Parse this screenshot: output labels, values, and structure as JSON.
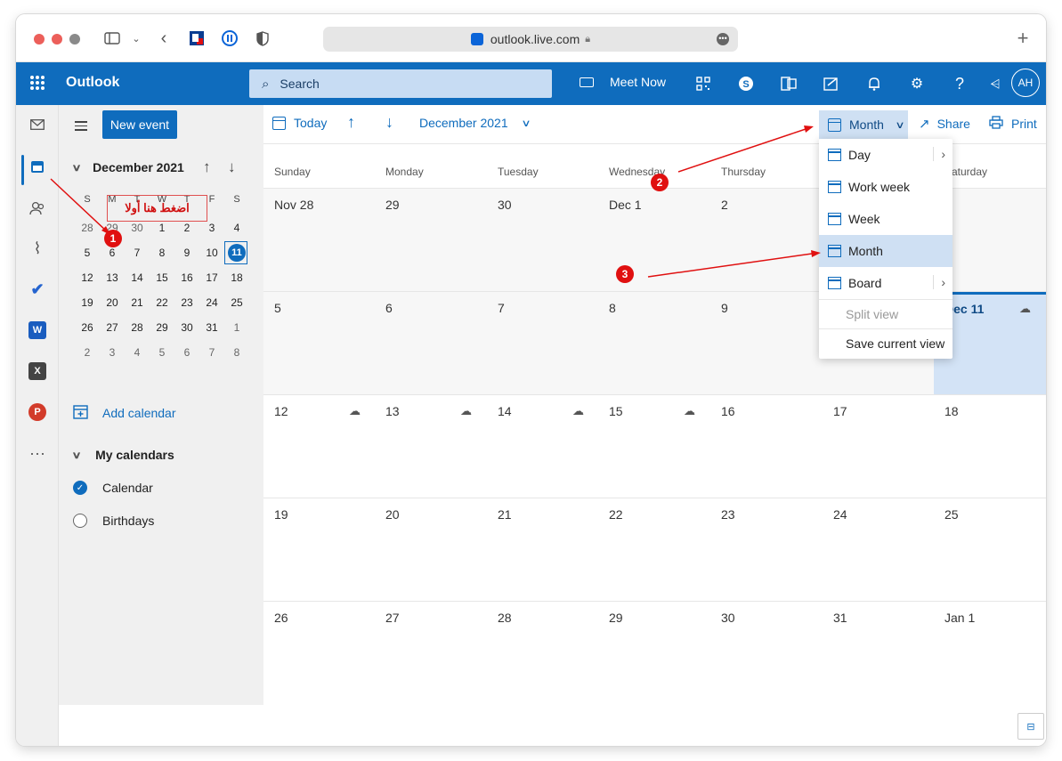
{
  "browser": {
    "url": "outlook.live.com"
  },
  "app": {
    "brand": "Outlook",
    "search_placeholder": "Search",
    "meet_now": "Meet Now",
    "avatar_initials": "AH"
  },
  "folder_pane": {
    "new_event": "New event",
    "mini_month": "December 2021",
    "dow": [
      "S",
      "M",
      "T",
      "W",
      "T",
      "F",
      "S"
    ],
    "weeks": [
      [
        "28",
        "29",
        "30",
        "1",
        "2",
        "3",
        "4"
      ],
      [
        "5",
        "6",
        "7",
        "8",
        "9",
        "10",
        "11"
      ],
      [
        "12",
        "13",
        "14",
        "15",
        "16",
        "17",
        "18"
      ],
      [
        "19",
        "20",
        "21",
        "22",
        "23",
        "24",
        "25"
      ],
      [
        "26",
        "27",
        "28",
        "29",
        "30",
        "31",
        "1"
      ],
      [
        "2",
        "3",
        "4",
        "5",
        "6",
        "7",
        "8"
      ]
    ],
    "add_calendar": "Add calendar",
    "my_calendars": "My calendars",
    "calendars": [
      "Calendar",
      "Birthdays"
    ]
  },
  "commands": {
    "today": "Today",
    "period": "December 2021",
    "view": "Month",
    "share": "Share",
    "print": "Print"
  },
  "grid": {
    "weekdays": [
      "Sunday",
      "Monday",
      "Tuesday",
      "Wednesday",
      "Thursday",
      "",
      "Saturday"
    ],
    "weeks": [
      [
        "Nov 28",
        "29",
        "30",
        "Dec 1",
        "2",
        "",
        ""
      ],
      [
        "5",
        "6",
        "7",
        "8",
        "9",
        "",
        "Dec 11"
      ],
      [
        "12",
        "13",
        "14",
        "15",
        "16",
        "17",
        "18"
      ],
      [
        "19",
        "20",
        "21",
        "22",
        "23",
        "24",
        "25"
      ],
      [
        "26",
        "27",
        "28",
        "29",
        "30",
        "31",
        "Jan 1"
      ]
    ]
  },
  "view_menu": {
    "items": [
      "Day",
      "Work week",
      "Week",
      "Month",
      "Board"
    ],
    "split_view": "Split view",
    "save_view": "Save current view"
  },
  "annotations": {
    "step1": "1",
    "step2": "2",
    "step3": "3",
    "hint": "اضغط هنا أولا"
  }
}
